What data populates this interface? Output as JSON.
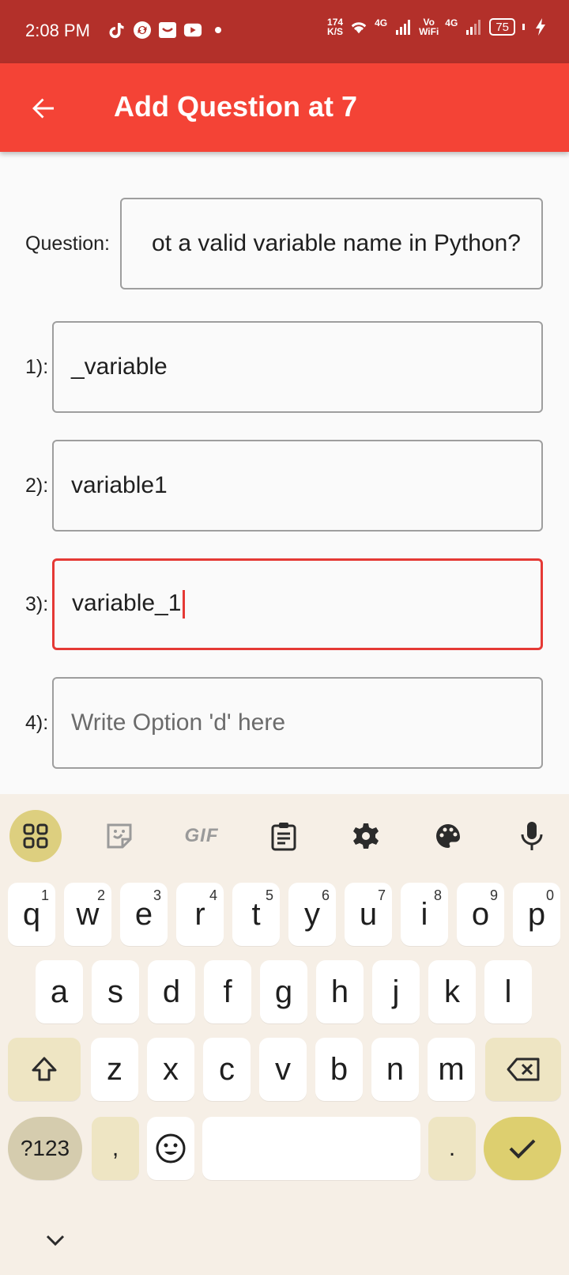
{
  "status_bar": {
    "time": "2:08 PM",
    "net_speed_value": "174",
    "net_speed_unit": "K/S",
    "signal1_label": "4G",
    "volte_label": "Vo",
    "wifi_label": "WiFi",
    "signal2_label": "4G",
    "battery": "75"
  },
  "app_bar": {
    "title": "Add Question at 7"
  },
  "form": {
    "question_label": "Question:",
    "question_value": "ot a valid variable name in Python?",
    "options": [
      {
        "label": "1):",
        "value": "_variable",
        "placeholder": ""
      },
      {
        "label": "2):",
        "value": "variable1",
        "placeholder": ""
      },
      {
        "label": "3):",
        "value": "variable_1",
        "placeholder": ""
      },
      {
        "label": "4):",
        "value": "",
        "placeholder": "Write Option 'd' here"
      }
    ]
  },
  "keyboard": {
    "toolbar_gif": "GIF",
    "row1": [
      {
        "k": "q",
        "h": "1"
      },
      {
        "k": "w",
        "h": "2"
      },
      {
        "k": "e",
        "h": "3"
      },
      {
        "k": "r",
        "h": "4"
      },
      {
        "k": "t",
        "h": "5"
      },
      {
        "k": "y",
        "h": "6"
      },
      {
        "k": "u",
        "h": "7"
      },
      {
        "k": "i",
        "h": "8"
      },
      {
        "k": "o",
        "h": "9"
      },
      {
        "k": "p",
        "h": "0"
      }
    ],
    "row2": [
      "a",
      "s",
      "d",
      "f",
      "g",
      "h",
      "j",
      "k",
      "l"
    ],
    "row3": [
      "z",
      "x",
      "c",
      "v",
      "b",
      "n",
      "m"
    ],
    "symbols_label": "?123",
    "comma": ",",
    "period": ".",
    "accent_color": "#ddcf6f"
  },
  "colors": {
    "status_bar": "#b3302a",
    "app_bar": "#f44336",
    "focus_border": "#e53935"
  }
}
